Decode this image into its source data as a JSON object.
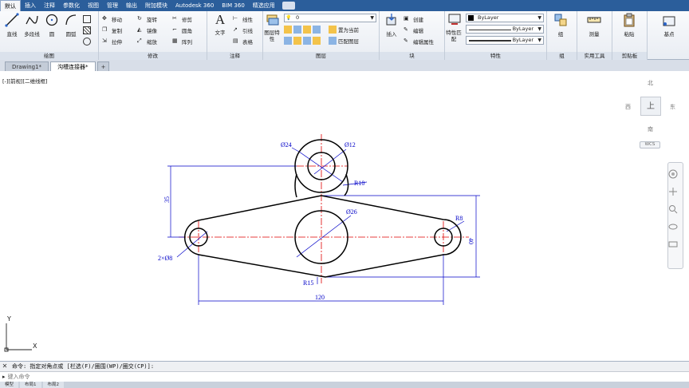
{
  "ribbon_tabs": [
    "默认",
    "插入",
    "注释",
    "参数化",
    "视图",
    "管理",
    "输出",
    "附加模块",
    "Autodesk 360",
    "BIM 360",
    "精选应用"
  ],
  "draw_panel": {
    "title": "绘图",
    "line": "直线",
    "polyline": "多段线",
    "circle": "圆",
    "arc": "圆弧"
  },
  "modify_panel": {
    "title": "修改",
    "move": "移动",
    "rotate": "旋转",
    "trim": "修剪",
    "copy": "复制",
    "mirror": "镜像",
    "fillet": "圆角",
    "stretch": "拉伸",
    "scale": "缩放",
    "array": "阵列"
  },
  "annotation_panel": {
    "title": "注释",
    "text": "文字",
    "linear": "线性",
    "leader": "引线",
    "table": "表格"
  },
  "layers_panel": {
    "title": "图层",
    "layer_properties": "图层特性",
    "current_layer": "0",
    "set_current": "置为当前",
    "match_layer": "匹配图层"
  },
  "block_panel": {
    "title": "块",
    "insert": "插入",
    "create": "创建",
    "edit": "编辑",
    "edit_attributes": "编辑属性"
  },
  "properties_panel": {
    "title": "特性",
    "match_properties": "特性匹配",
    "color": "ByLayer",
    "linetype": "ByLayer",
    "lineweight": "ByLayer"
  },
  "groups_panel": {
    "title": "组",
    "group": "组"
  },
  "utilities_panel": {
    "title": "实用工具",
    "measure": "测量"
  },
  "clipboard_panel": {
    "title": "剪贴板",
    "paste": "粘贴"
  },
  "base_panel": {
    "base": "基点"
  },
  "doc_tabs": [
    "Drawing1*",
    "沟槽连接器*"
  ],
  "viewport_label": "[-][前视][二维线框]",
  "viewcube": {
    "north": "北",
    "south": "南",
    "east": "东",
    "west": "西",
    "face": "上",
    "wcs": "WCS"
  },
  "drawing": {
    "dim_d24": "Ø24",
    "dim_d12": "Ø12",
    "dim_r10": "R10",
    "dim_d26": "Ø26",
    "dim_r8": "R8",
    "dim_2xd8": "2×Ø8",
    "dim_35": "35",
    "dim_40": "40",
    "dim_r15": "R15",
    "dim_120": "120",
    "ucs_x": "X",
    "ucs_y": "Y",
    "line_color": "#000000",
    "center_color": "#e00000",
    "dim_color": "#0000c8"
  },
  "command": {
    "history": "命令: 指定对角点或 [栏选(F)/圈围(WP)/圈交(CP)]:",
    "placeholder": "键入命令"
  },
  "layout_tabs": [
    "模型",
    "布局1",
    "布局2"
  ]
}
